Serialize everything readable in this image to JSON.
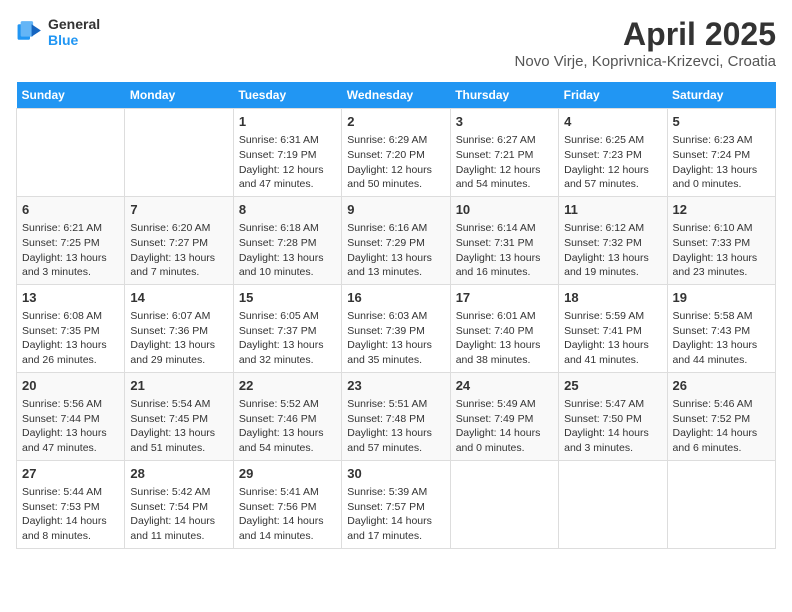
{
  "logo": {
    "line1": "General",
    "line2": "Blue"
  },
  "title": "April 2025",
  "subtitle": "Novo Virje, Koprivnica-Krizevci, Croatia",
  "days_header": [
    "Sunday",
    "Monday",
    "Tuesday",
    "Wednesday",
    "Thursday",
    "Friday",
    "Saturday"
  ],
  "weeks": [
    [
      {
        "num": "",
        "info": ""
      },
      {
        "num": "",
        "info": ""
      },
      {
        "num": "1",
        "info": "Sunrise: 6:31 AM\nSunset: 7:19 PM\nDaylight: 12 hours and 47 minutes."
      },
      {
        "num": "2",
        "info": "Sunrise: 6:29 AM\nSunset: 7:20 PM\nDaylight: 12 hours and 50 minutes."
      },
      {
        "num": "3",
        "info": "Sunrise: 6:27 AM\nSunset: 7:21 PM\nDaylight: 12 hours and 54 minutes."
      },
      {
        "num": "4",
        "info": "Sunrise: 6:25 AM\nSunset: 7:23 PM\nDaylight: 12 hours and 57 minutes."
      },
      {
        "num": "5",
        "info": "Sunrise: 6:23 AM\nSunset: 7:24 PM\nDaylight: 13 hours and 0 minutes."
      }
    ],
    [
      {
        "num": "6",
        "info": "Sunrise: 6:21 AM\nSunset: 7:25 PM\nDaylight: 13 hours and 3 minutes."
      },
      {
        "num": "7",
        "info": "Sunrise: 6:20 AM\nSunset: 7:27 PM\nDaylight: 13 hours and 7 minutes."
      },
      {
        "num": "8",
        "info": "Sunrise: 6:18 AM\nSunset: 7:28 PM\nDaylight: 13 hours and 10 minutes."
      },
      {
        "num": "9",
        "info": "Sunrise: 6:16 AM\nSunset: 7:29 PM\nDaylight: 13 hours and 13 minutes."
      },
      {
        "num": "10",
        "info": "Sunrise: 6:14 AM\nSunset: 7:31 PM\nDaylight: 13 hours and 16 minutes."
      },
      {
        "num": "11",
        "info": "Sunrise: 6:12 AM\nSunset: 7:32 PM\nDaylight: 13 hours and 19 minutes."
      },
      {
        "num": "12",
        "info": "Sunrise: 6:10 AM\nSunset: 7:33 PM\nDaylight: 13 hours and 23 minutes."
      }
    ],
    [
      {
        "num": "13",
        "info": "Sunrise: 6:08 AM\nSunset: 7:35 PM\nDaylight: 13 hours and 26 minutes."
      },
      {
        "num": "14",
        "info": "Sunrise: 6:07 AM\nSunset: 7:36 PM\nDaylight: 13 hours and 29 minutes."
      },
      {
        "num": "15",
        "info": "Sunrise: 6:05 AM\nSunset: 7:37 PM\nDaylight: 13 hours and 32 minutes."
      },
      {
        "num": "16",
        "info": "Sunrise: 6:03 AM\nSunset: 7:39 PM\nDaylight: 13 hours and 35 minutes."
      },
      {
        "num": "17",
        "info": "Sunrise: 6:01 AM\nSunset: 7:40 PM\nDaylight: 13 hours and 38 minutes."
      },
      {
        "num": "18",
        "info": "Sunrise: 5:59 AM\nSunset: 7:41 PM\nDaylight: 13 hours and 41 minutes."
      },
      {
        "num": "19",
        "info": "Sunrise: 5:58 AM\nSunset: 7:43 PM\nDaylight: 13 hours and 44 minutes."
      }
    ],
    [
      {
        "num": "20",
        "info": "Sunrise: 5:56 AM\nSunset: 7:44 PM\nDaylight: 13 hours and 47 minutes."
      },
      {
        "num": "21",
        "info": "Sunrise: 5:54 AM\nSunset: 7:45 PM\nDaylight: 13 hours and 51 minutes."
      },
      {
        "num": "22",
        "info": "Sunrise: 5:52 AM\nSunset: 7:46 PM\nDaylight: 13 hours and 54 minutes."
      },
      {
        "num": "23",
        "info": "Sunrise: 5:51 AM\nSunset: 7:48 PM\nDaylight: 13 hours and 57 minutes."
      },
      {
        "num": "24",
        "info": "Sunrise: 5:49 AM\nSunset: 7:49 PM\nDaylight: 14 hours and 0 minutes."
      },
      {
        "num": "25",
        "info": "Sunrise: 5:47 AM\nSunset: 7:50 PM\nDaylight: 14 hours and 3 minutes."
      },
      {
        "num": "26",
        "info": "Sunrise: 5:46 AM\nSunset: 7:52 PM\nDaylight: 14 hours and 6 minutes."
      }
    ],
    [
      {
        "num": "27",
        "info": "Sunrise: 5:44 AM\nSunset: 7:53 PM\nDaylight: 14 hours and 8 minutes."
      },
      {
        "num": "28",
        "info": "Sunrise: 5:42 AM\nSunset: 7:54 PM\nDaylight: 14 hours and 11 minutes."
      },
      {
        "num": "29",
        "info": "Sunrise: 5:41 AM\nSunset: 7:56 PM\nDaylight: 14 hours and 14 minutes."
      },
      {
        "num": "30",
        "info": "Sunrise: 5:39 AM\nSunset: 7:57 PM\nDaylight: 14 hours and 17 minutes."
      },
      {
        "num": "",
        "info": ""
      },
      {
        "num": "",
        "info": ""
      },
      {
        "num": "",
        "info": ""
      }
    ]
  ]
}
